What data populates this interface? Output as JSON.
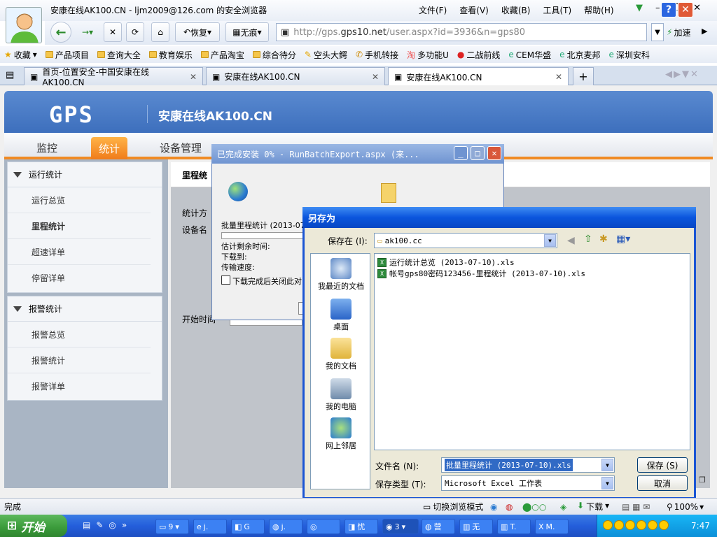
{
  "browser": {
    "title": "安康在线AK100.CN - ljm2009@126.com 的安全浏览器",
    "menus": [
      "文件(F)",
      "查看(V)",
      "收藏(B)",
      "工具(T)",
      "帮助(H)"
    ],
    "nav": {
      "restore": "恢复",
      "notrace": "无痕",
      "accelerate": "加速"
    },
    "address": {
      "prefix": "http://gps.",
      "domain": "gps10.net",
      "suffix": "/user.aspx?id=3936&n=gps80"
    },
    "favorites_label": "收藏",
    "favorites": [
      "产品项目",
      "查询大全",
      "教育娱乐",
      "产品淘宝",
      "综合待分",
      "空头大鳄",
      "手机转接",
      "多功能U",
      "二战前线",
      "CEM华盛",
      "北京麦邦",
      "深圳安科"
    ],
    "tabs": [
      {
        "label": "首页-位置安全-中国安康在线AK100.CN"
      },
      {
        "label": "安康在线AK100.CN"
      },
      {
        "label": "安康在线AK100.CN"
      }
    ]
  },
  "site": {
    "logo": "GPS",
    "name": "安康在线AK100.CN",
    "nav": [
      "监控",
      "统计",
      "设备管理"
    ],
    "sidebar": {
      "section1": {
        "title": "运行统计",
        "items": [
          "运行总览",
          "里程统计",
          "超速详单",
          "停留详单"
        ]
      },
      "section2": {
        "title": "报警统计",
        "items": [
          "报警总览",
          "报警统计",
          "报警详单"
        ]
      }
    },
    "content": {
      "title": "里程统",
      "labels": [
        "统计方",
        "设备名",
        "开始时间"
      ]
    }
  },
  "download_dialog": {
    "title": "已完成安装 0% - RunBatchExport.aspx (来...",
    "file": "批量里程统计 (2013-07",
    "remaining": "估计剩余时间:",
    "download_to": "下载到:",
    "speed": "传输速度:",
    "close_check": "下载完成后关闭此对"
  },
  "save_dialog": {
    "title": "另存为",
    "save_in_label": "保存在 (I):",
    "save_in_value": "ak100.cc",
    "places": [
      "我最近的文档",
      "桌面",
      "我的文档",
      "我的电脑",
      "网上邻居"
    ],
    "files": [
      "运行统计总览 (2013-07-10).xls",
      "帐号gps80密码123456-里程统计 (2013-07-10).xls"
    ],
    "filename_label": "文件名 (N):",
    "filename_value": "批量里程统计 (2013-07-10).xls",
    "filetype_label": "保存类型 (T):",
    "filetype_value": "Microsoft Excel 工作表",
    "save_button": "保存 (S)",
    "cancel_button": "取消"
  },
  "statusbar": {
    "left": "完成",
    "mode": "切换浏览模式",
    "download": "下载",
    "zoom": "100%"
  },
  "taskbar": {
    "start": "开始",
    "items": [
      "9",
      "j.",
      "G",
      "j.",
      "",
      "忧",
      "3",
      "营",
      "无",
      "T.",
      "M."
    ],
    "clock": "7:47"
  }
}
